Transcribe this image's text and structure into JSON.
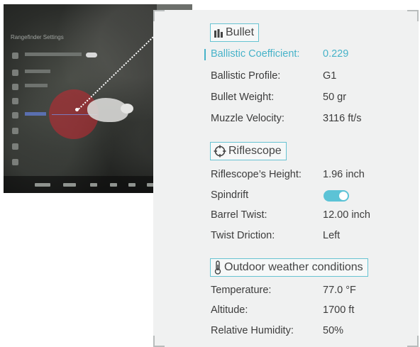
{
  "device_screen": {
    "menu_title": "Rangefinder Settings"
  },
  "panel": {
    "bullet": {
      "title": "Bullet",
      "rows": [
        {
          "label": "Ballistic Coefficient:",
          "value": "0.229",
          "highlighted": true
        },
        {
          "label": "Ballistic Profile:",
          "value": "G1"
        },
        {
          "label": "Bullet Weight:",
          "value": "50 gr"
        },
        {
          "label": "Muzzle Velocity:",
          "value": "3116 ft/s"
        }
      ]
    },
    "riflescope": {
      "title": "Riflescope",
      "rows": [
        {
          "label": "Riflescope’s Height:",
          "value": "1.96 inch"
        },
        {
          "label": "Spindrift",
          "value": ""
        },
        {
          "label": "Barrel Twist:",
          "value": "12.00 inch"
        },
        {
          "label": "Twist Driction:",
          "value": "Left"
        }
      ],
      "spindrift_enabled": true
    },
    "weather": {
      "title": "Outdoor weather conditions",
      "rows": [
        {
          "label": "Temperature:",
          "value": "77.0 °F"
        },
        {
          "label": "Altitude:",
          "value": "1700 ft"
        },
        {
          "label": "Relative Humidity:",
          "value": "50%"
        }
      ]
    }
  },
  "colors": {
    "accent": "#47b3c9",
    "panel_bg": "#f0f1f1",
    "text": "#3c3c3c"
  },
  "icons": {
    "bullet": "bullet-icon",
    "riflescope": "crosshair-icon",
    "weather": "thermometer-icon"
  }
}
